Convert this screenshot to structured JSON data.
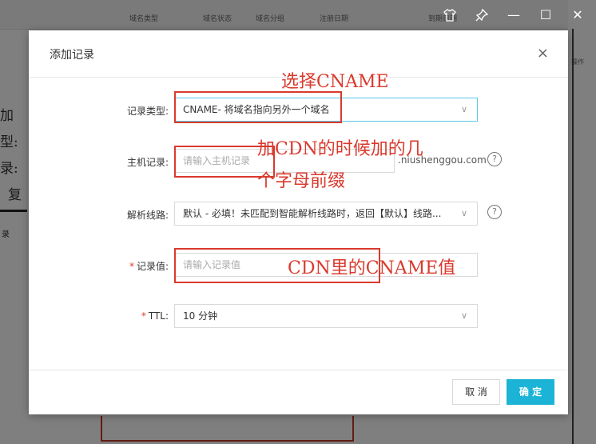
{
  "background": {
    "header_cols": [
      "域名类型",
      "域名状态",
      "域名分组",
      "注册日期",
      "到期日期"
    ],
    "left_fragments": [
      "加",
      "型:",
      "录:",
      "复"
    ],
    "left_small": "录",
    "right_fragments": [
      "操作"
    ]
  },
  "window_controls": {
    "shirt_icon": "shirt-icon",
    "pin_icon": "pin-icon",
    "minimize": "—",
    "maximize": "☐",
    "close": "✕"
  },
  "modal": {
    "title": "添加记录",
    "close": "×",
    "fields": {
      "record_type": {
        "label": "记录类型:",
        "value": "CNAME- 将域名指向另外一个域名"
      },
      "host": {
        "label": "主机记录:",
        "placeholder": "请输入主机记录",
        "suffix": ".niushenggou.com"
      },
      "line": {
        "label": "解析线路:",
        "value": "默认 - 必填！未匹配到智能解析线路时，返回【默认】线路..."
      },
      "value": {
        "required": "*",
        "label": "记录值:",
        "placeholder": "请输入记录值"
      },
      "ttl": {
        "required": "*",
        "label": "TTL:",
        "value": "10 分钟"
      }
    },
    "buttons": {
      "cancel": "取 消",
      "ok": "确 定"
    }
  },
  "annotations": {
    "a1": "选择CNAME",
    "a2_line1": "加CDN的时候加的几",
    "a2_line2": "个字母前缀",
    "a3": "CDN里的CNAME值"
  },
  "colors": {
    "accent": "#1bb3d6",
    "annotation": "#d93a2e",
    "required": "#e03c2c"
  }
}
